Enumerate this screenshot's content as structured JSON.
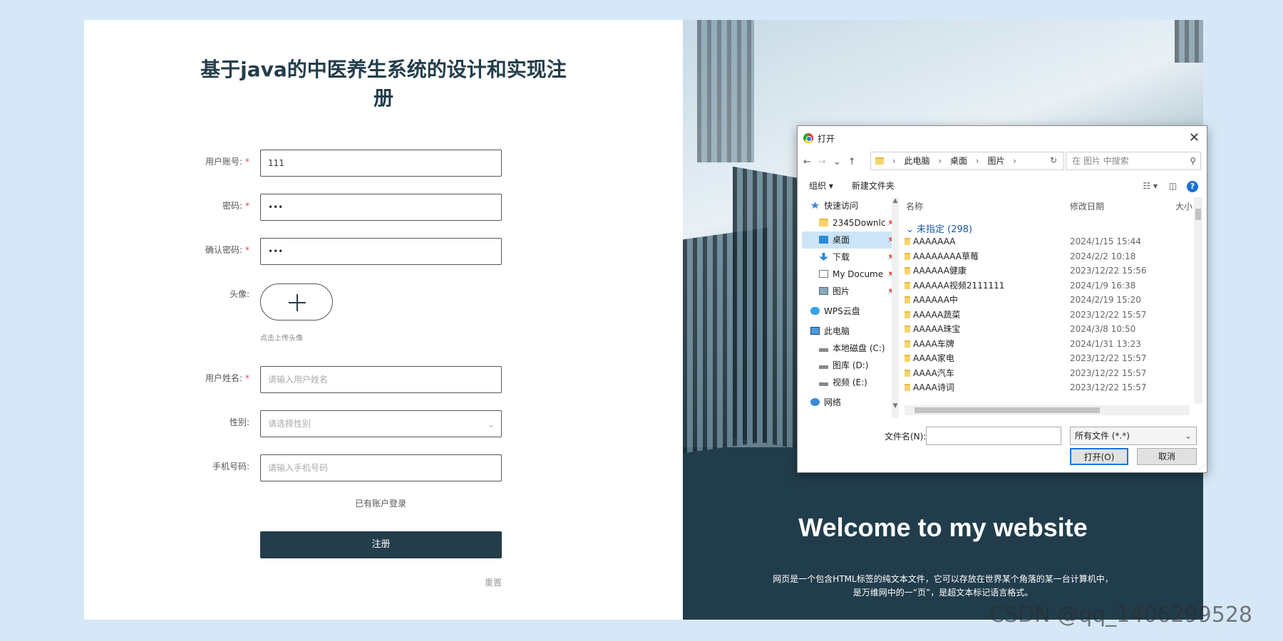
{
  "form": {
    "title": "基于java的中医养生系统的设计和实现注册",
    "fields": [
      {
        "label": "用户账号:",
        "value": "111",
        "required": true
      },
      {
        "label": "密码:",
        "value": "•••",
        "required": true
      },
      {
        "label": "确认密码:",
        "value": "•••",
        "required": true
      }
    ],
    "avatar_label": "头像:",
    "avatar_hint": "点击上传头像",
    "name_label": "用户姓名:",
    "name_placeholder": "请输入用户姓名",
    "gender_label": "性别:",
    "gender_placeholder": "请选择性别",
    "phone_label": "手机号码:",
    "phone_placeholder": "请输入手机号码",
    "login_link": "已有账户登录",
    "register_button": "注册",
    "reset_link": "重置",
    "required_mark": "*"
  },
  "hero": {
    "heading": "Welcome to my website",
    "description_line1": "网页是一个包含HTML标签的纯文本文件，它可以存放在世界某个角落的某一台计算机中，",
    "description_line2": "是万维网中的一“页”，是超文本标记语言格式。"
  },
  "dialog": {
    "title": "打开",
    "nav_buttons": {
      "back": "←",
      "forward": "→",
      "recent": "⌄",
      "up": "↑"
    },
    "path": [
      "此电脑",
      "桌面",
      "图片"
    ],
    "search_placeholder": "在 图片 中搜索",
    "organize": "组织 ▾",
    "new_folder": "新建文件夹",
    "nav_items": [
      {
        "label": "快速访问",
        "icon": "star-icon",
        "pinned": false
      },
      {
        "label": "2345Downlc",
        "icon": "folder-icon",
        "pinned": true
      },
      {
        "label": "桌面",
        "icon": "desktop-icon",
        "pinned": true,
        "selected": true
      },
      {
        "label": "下载",
        "icon": "download-icon",
        "pinned": true
      },
      {
        "label": "My Docume",
        "icon": "document-icon",
        "pinned": true
      },
      {
        "label": "图片",
        "icon": "pictures-icon",
        "pinned": true
      },
      {
        "label": "WPS云盘",
        "icon": "cloud-icon",
        "pinned": false
      },
      {
        "label": "此电脑",
        "icon": "computer-icon",
        "pinned": false
      },
      {
        "label": "本地磁盘 (C:)",
        "icon": "drive-icon",
        "pinned": false
      },
      {
        "label": "图库 (D:)",
        "icon": "drive-icon",
        "pinned": false
      },
      {
        "label": "视频 (E:)",
        "icon": "drive-icon",
        "pinned": false
      },
      {
        "label": "网络",
        "icon": "network-icon",
        "pinned": false
      }
    ],
    "columns": {
      "name": "名称",
      "date": "修改日期",
      "size": "大小"
    },
    "group": "未指定 (298)",
    "files": [
      {
        "name": "AAAAAAA",
        "date": "2024/1/15 15:44"
      },
      {
        "name": "AAAAAAAA草莓",
        "date": "2024/2/2 10:18"
      },
      {
        "name": "AAAAAA健康",
        "date": "2023/12/22 15:56"
      },
      {
        "name": "AAAAAA视频2111111",
        "date": "2024/1/9 16:38"
      },
      {
        "name": "AAAAAA中",
        "date": "2024/2/19 15:20"
      },
      {
        "name": "AAAAA蔬菜",
        "date": "2023/12/22 15:57"
      },
      {
        "name": "AAAAA珠宝",
        "date": "2024/3/8 10:50"
      },
      {
        "name": "AAAA车牌",
        "date": "2024/1/31 13:23"
      },
      {
        "name": "AAAA家电",
        "date": "2023/12/22 15:57"
      },
      {
        "name": "AAAA汽车",
        "date": "2023/12/22 15:57"
      },
      {
        "name": "AAAA诗词",
        "date": "2023/12/22 15:57"
      }
    ],
    "filename_label": "文件名(N):",
    "filename_value": "",
    "filetype": "所有文件 (*.*)",
    "open_button": "打开(O)",
    "cancel_button": "取消"
  },
  "watermark": "CSDN @qq_1406299528",
  "colors": {
    "accent": "#243d4b",
    "page_bg": "#d6e8f7",
    "required": "#e44444",
    "link": "#1a73d6"
  }
}
